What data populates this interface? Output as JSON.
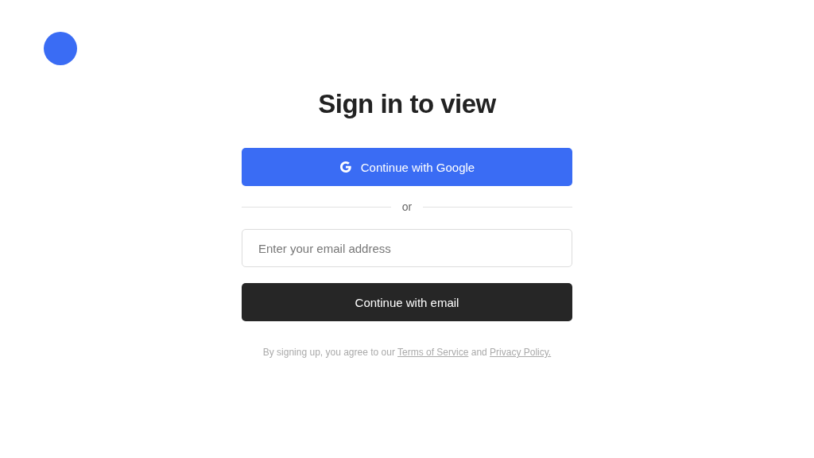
{
  "title": "Sign in to view",
  "google_button": {
    "label": "Continue with Google"
  },
  "divider": {
    "label": "or"
  },
  "email_field": {
    "placeholder": "Enter your email address"
  },
  "email_button": {
    "label": "Continue with email"
  },
  "legal": {
    "lead": "By signing up, you agree to our",
    "terms_link": "Terms of Service",
    "joiner": "and",
    "privacy_link": "Privacy Policy."
  }
}
